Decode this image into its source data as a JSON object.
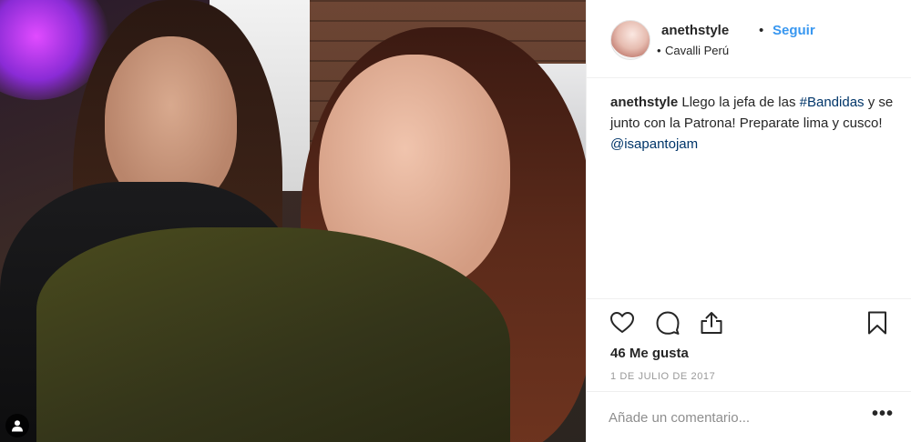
{
  "post": {
    "username": "anethstyle",
    "separator": "•",
    "follow_label": "Seguir",
    "location_bullet": "•",
    "location": "Cavalli Perú",
    "caption": {
      "user": "anethstyle",
      "text_1": " Llego la jefa de las ",
      "hashtag": "#Bandidas",
      "text_2": " y se junto con la Patrona! Preparate lima y cusco! ",
      "mention": "@isapantojam"
    },
    "likes_label": "46 Me gusta",
    "date": "1 DE JULIO DE 2017",
    "comment": {
      "placeholder": "Añade un comentario...",
      "more_label": "•••"
    }
  },
  "icons": {
    "like": "heart-icon",
    "comment": "comment-bubble-icon",
    "share": "share-upload-icon",
    "save": "bookmark-icon",
    "user_tag": "user-silhouette-icon"
  },
  "colors": {
    "text": "#262626",
    "accent": "#3897f0",
    "link": "#003569",
    "muted": "#999999",
    "divider": "#efefef"
  }
}
